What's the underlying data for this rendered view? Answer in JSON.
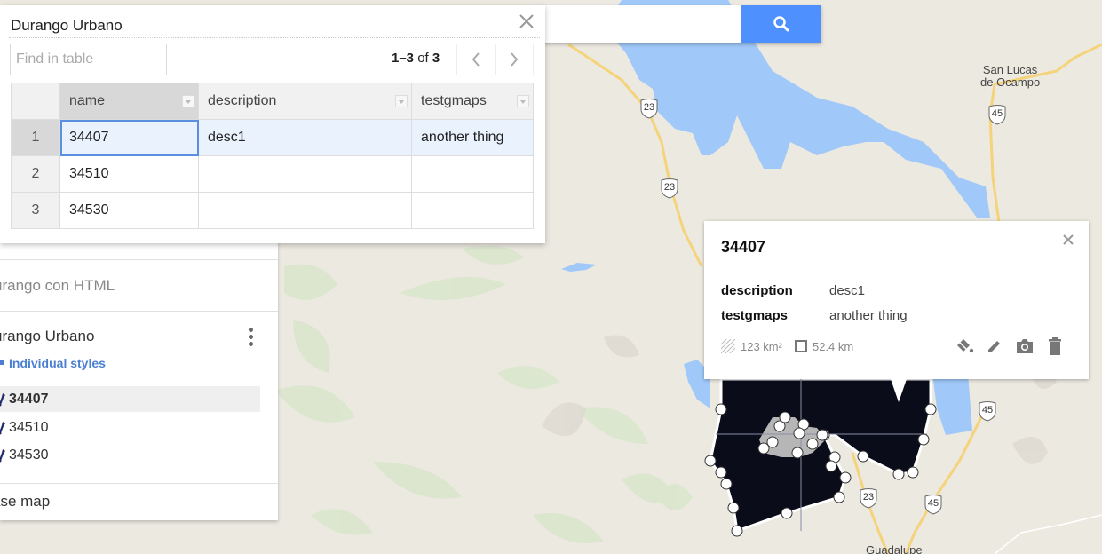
{
  "search": {
    "value": "",
    "placeholder": "",
    "button_icon": "search-icon"
  },
  "table_panel": {
    "title": "Durango Urbano",
    "find_placeholder": "Find in table",
    "count_range": "1–3",
    "count_of": "of",
    "count_total": "3",
    "close_icon": "close-icon",
    "prev_icon": "chevron-left-icon",
    "next_icon": "chevron-right-icon",
    "columns": [
      "name",
      "description",
      "testgmaps"
    ],
    "rows": [
      {
        "num": "1",
        "name": "34407",
        "description": "desc1",
        "testgmaps": "another thing",
        "selected": true
      },
      {
        "num": "2",
        "name": "34510",
        "description": "",
        "testgmaps": "",
        "selected": false
      },
      {
        "num": "3",
        "name": "34530",
        "description": "",
        "testgmaps": "",
        "selected": false
      }
    ]
  },
  "sidebar": {
    "layer_prev": "urango con HTML",
    "layer_title": "urango Urbano",
    "styles_link": "Individual styles",
    "items": [
      {
        "label": "34407",
        "selected": true
      },
      {
        "label": "34510",
        "selected": false
      },
      {
        "label": "34530",
        "selected": false
      }
    ],
    "base_map": "ase map"
  },
  "info_window": {
    "title": "34407",
    "fields": [
      {
        "key": "description",
        "value": "desc1"
      },
      {
        "key": "testgmaps",
        "value": "another thing"
      }
    ],
    "area": "123 km²",
    "perimeter": "52.4 km",
    "actions": [
      "style-icon",
      "edit-icon",
      "camera-icon",
      "delete-icon"
    ]
  },
  "map": {
    "labels": {
      "town1_line1": "San Lucas",
      "town1_line2": "de Ocampo",
      "town2": "Guadalupe"
    },
    "shields": [
      "23",
      "23",
      "45",
      "45",
      "23",
      "45"
    ],
    "colors": {
      "land": "#ece9e1",
      "water": "#a0c8f8",
      "road": "#f5d37a",
      "polygon": "#0a0c1a",
      "accent": "#4d90fe"
    }
  }
}
